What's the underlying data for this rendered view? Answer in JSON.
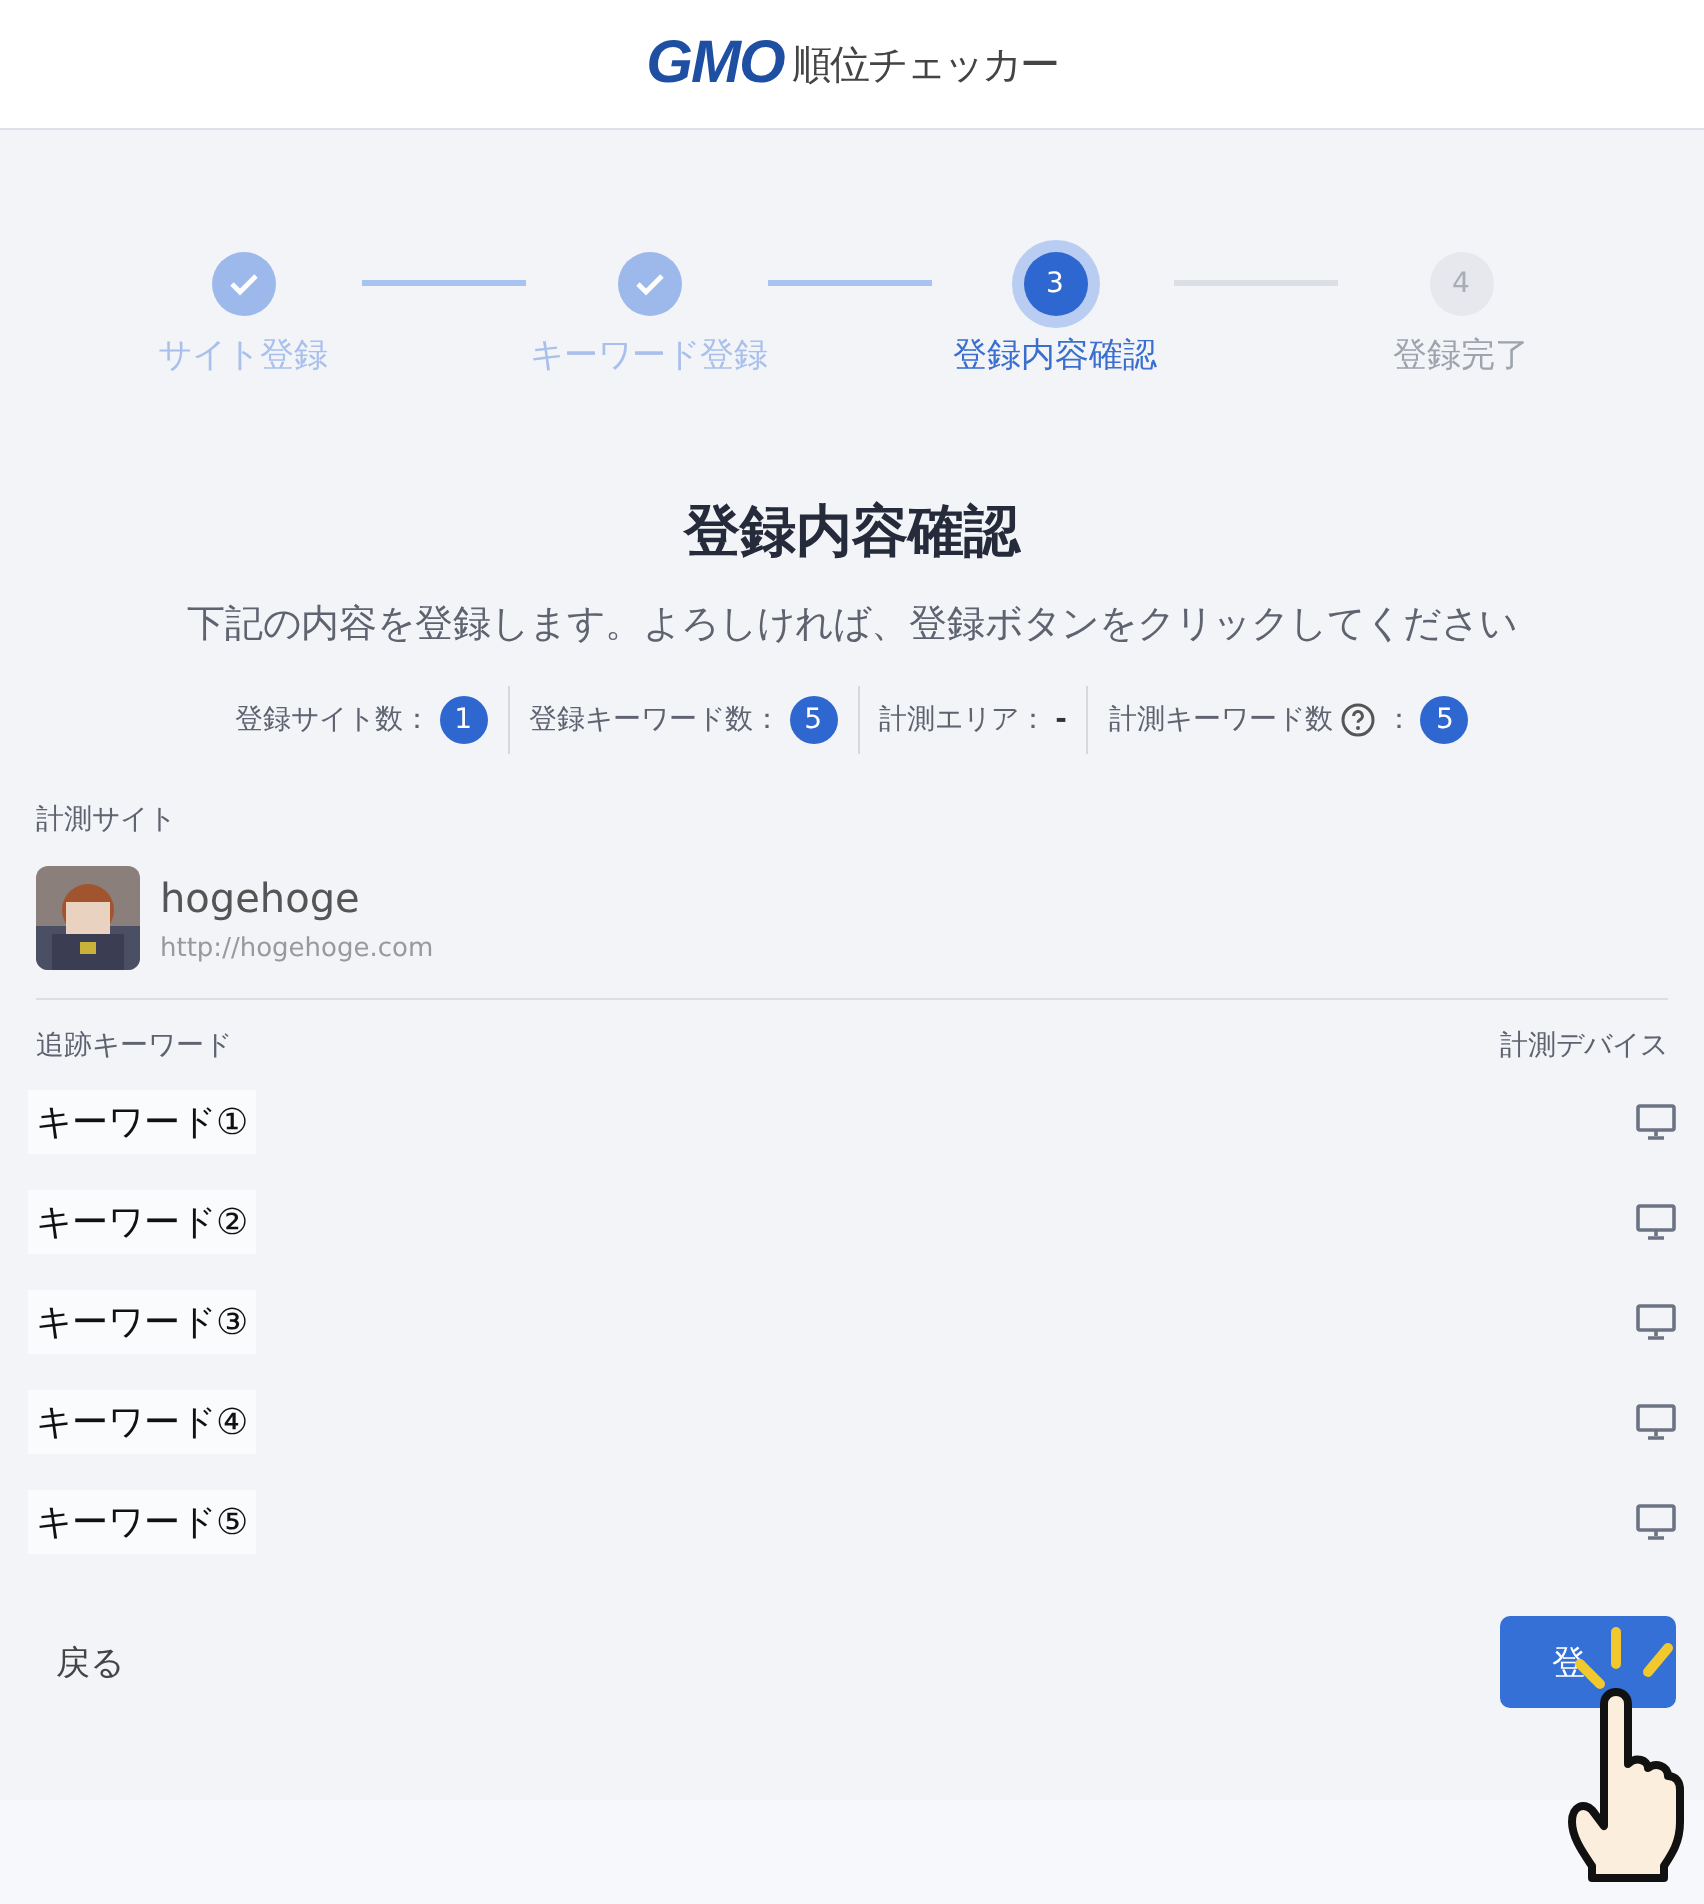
{
  "header": {
    "logo_mark": "GMO",
    "logo_text": "順位チェッカー"
  },
  "steps": [
    {
      "label": "サイト登録",
      "completed": true,
      "selected": false
    },
    {
      "label": "キーワード登録",
      "completed": true,
      "selected": false
    },
    {
      "number": "3",
      "label": "登録内容確認",
      "completed": false,
      "selected": true
    },
    {
      "number": "4",
      "label": "登録完了",
      "completed": false,
      "selected": false
    }
  ],
  "title": "登録内容確認",
  "description": "下記の内容を登録します。よろしければ、登録ボタンをクリックしてください",
  "stats": [
    {
      "label": "登録サイト数：",
      "value": "1",
      "kind": "badge"
    },
    {
      "label": "登録キーワード数：",
      "value": "5",
      "kind": "badge"
    },
    {
      "label": "計測エリア：",
      "value": "-",
      "kind": "plain"
    },
    {
      "label": "計測キーワード数",
      "suffix": "：",
      "value": "5",
      "kind": "help"
    }
  ],
  "site": {
    "heading": "計測サイト",
    "name": "hogehoge",
    "url": "http://hogehoge.com"
  },
  "keywords": {
    "column_1": "追跡キーワード",
    "column_2": "計測デバイス",
    "rows": [
      {
        "keyword": "キーワード①"
      },
      {
        "keyword": "キーワード②"
      },
      {
        "keyword": "キーワード③"
      },
      {
        "keyword": "キーワード④"
      },
      {
        "keyword": "キーワード⑤"
      }
    ]
  },
  "back_link": "戻る",
  "submit_button": "登"
}
